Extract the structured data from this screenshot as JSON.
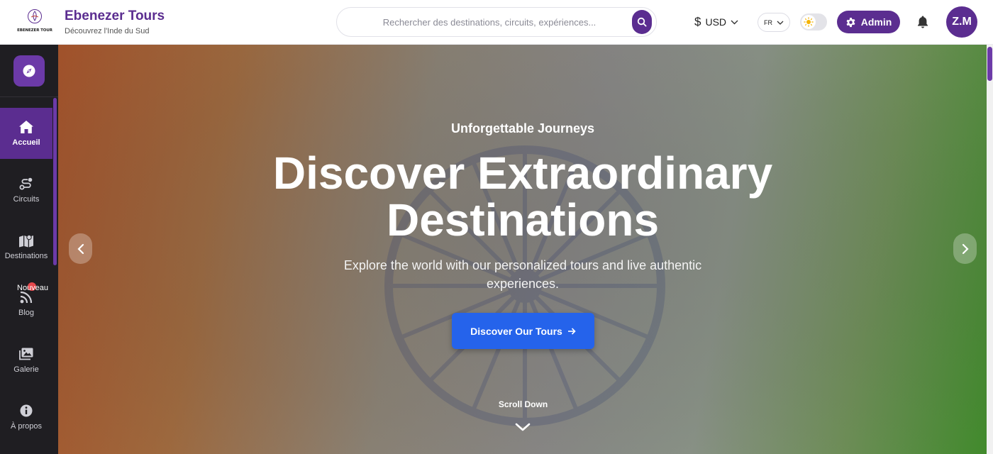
{
  "header": {
    "logo_text": "EBENEZER TOUR",
    "brand_name": "Ebenezer Tours",
    "brand_tagline": "Découvrez l'Inde du Sud",
    "search_placeholder": "Rechercher des destinations, circuits, expériences...",
    "currency_symbol": "$",
    "currency_code": "USD",
    "language": "FR",
    "admin_label": "Admin",
    "avatar_initials": "Z.M",
    "icons": [
      "search-icon",
      "chevron-down-icon",
      "sun-icon",
      "gear-icon",
      "bell-icon"
    ]
  },
  "sidebar": {
    "items": [
      {
        "label": "Accueil",
        "icon": "home-icon",
        "active": true
      },
      {
        "label": "Circuits",
        "icon": "route-icon",
        "active": false
      },
      {
        "label": "Destinations",
        "icon": "map-icon",
        "active": false
      },
      {
        "label": "Blog",
        "icon": "rss-icon",
        "active": false,
        "badge": "Nouveau"
      },
      {
        "label": "Galerie",
        "icon": "gallery-icon",
        "active": false
      },
      {
        "label": "À propos",
        "icon": "info-icon",
        "active": false
      }
    ]
  },
  "hero": {
    "eyebrow": "Unforgettable Journeys",
    "title_line1": "Discover Extraordinary",
    "title_line2": "Destinations",
    "subtitle": "Explore the world with our personalized tours and live authentic experiences.",
    "cta_label": "Discover Our Tours",
    "scroll_label": "Scroll Down"
  },
  "colors": {
    "brand": "#5b2d90",
    "brand_light": "#6c3aa8",
    "sidebar_bg": "#1f1e22",
    "cta": "#2563eb",
    "badge": "#e5484d"
  }
}
